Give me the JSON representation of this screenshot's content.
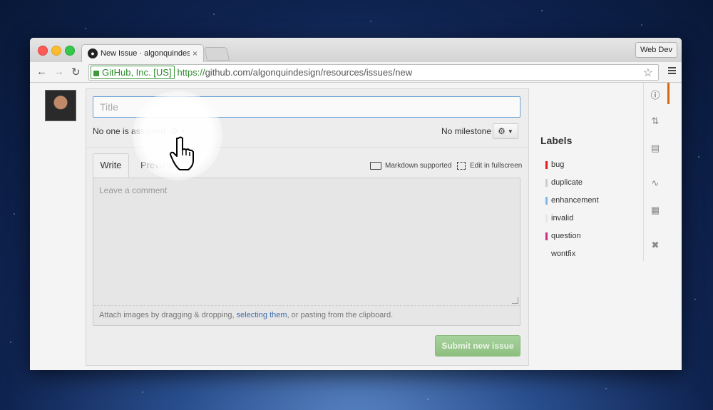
{
  "browser": {
    "tab_title": "New Issue · algonquindesig",
    "tab_close": "×",
    "profile": "Web Dev",
    "ev_cert": "GitHub, Inc. [US]",
    "url_scheme": "https://",
    "url_rest": "github.com/algonquindesign/resources/issues/new"
  },
  "issue_form": {
    "title_placeholder": "Title",
    "assignee_text": "No one is assigned",
    "milestone_text": "No milestone",
    "tab_write": "Write",
    "tab_preview": "Preview",
    "markdown_supported": "Markdown supported",
    "edit_fullscreen": "Edit in fullscreen",
    "comment_placeholder": "Leave a comment",
    "attach_prefix": "Attach images by dragging & dropping, ",
    "attach_link": "selecting them",
    "attach_suffix": ", or pasting from the clipboard.",
    "submit_label": "Submit new issue"
  },
  "labels": {
    "heading": "Labels",
    "items": [
      {
        "name": "bug",
        "color": "#e11d21"
      },
      {
        "name": "duplicate",
        "color": "#cccccc"
      },
      {
        "name": "enhancement",
        "color": "#84b6eb"
      },
      {
        "name": "invalid",
        "color": "#e6e6e6"
      },
      {
        "name": "question",
        "color": "#cc317c"
      },
      {
        "name": "wontfix",
        "color": ""
      }
    ]
  },
  "right_rail": {
    "items": [
      "issues-icon",
      "pull-requests-icon",
      "wiki-icon",
      "pulse-icon",
      "graphs-icon",
      "settings-icon"
    ],
    "active_color": "#d26911"
  }
}
